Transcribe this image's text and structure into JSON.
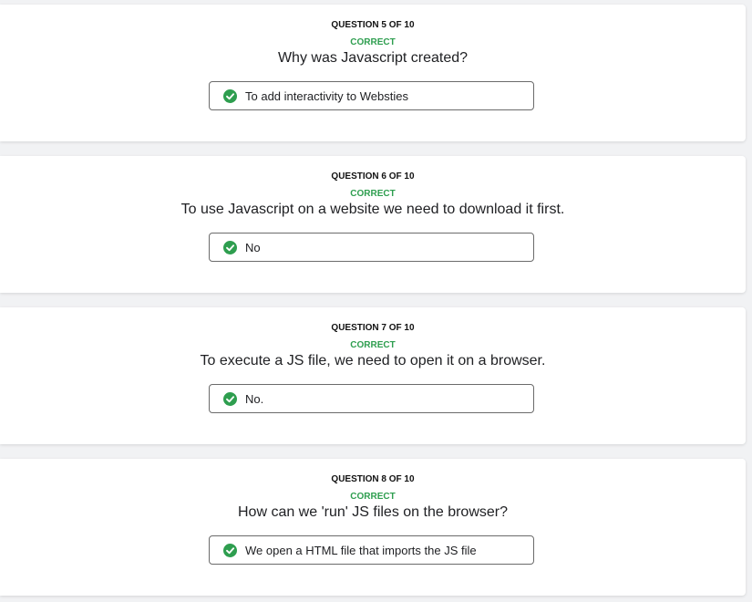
{
  "colors": {
    "correct": "#2e9e4f",
    "background": "#f1f2f4"
  },
  "questions": [
    {
      "header": "QUESTION 5 OF 10",
      "status": "CORRECT",
      "text": "Why was Javascript created?",
      "answer": "To add interactivity to Websties",
      "icon": "check-circle-icon"
    },
    {
      "header": "QUESTION 6 OF 10",
      "status": "CORRECT",
      "text": "To use Javascript on a website we need to download it first.",
      "answer": "No",
      "icon": "check-circle-icon"
    },
    {
      "header": "QUESTION 7 OF 10",
      "status": "CORRECT",
      "text": "To execute a JS file, we need to open it on a browser.",
      "answer": "No.",
      "icon": "check-circle-icon"
    },
    {
      "header": "QUESTION 8 OF 10",
      "status": "CORRECT",
      "text": "How can we 'run' JS files on the browser?",
      "answer": "We open a HTML file that imports the JS file",
      "icon": "check-circle-icon"
    }
  ]
}
